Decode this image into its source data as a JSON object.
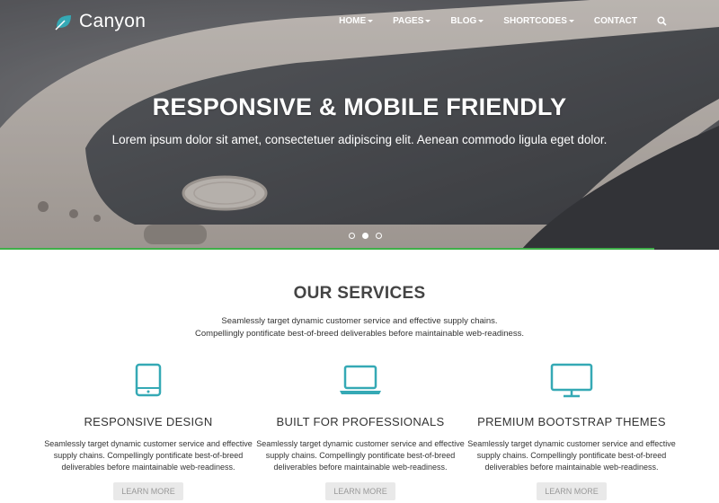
{
  "brand": {
    "name": "Canyon",
    "icon": "leaf-icon"
  },
  "nav": {
    "items": [
      {
        "label": "HOME",
        "dropdown": true
      },
      {
        "label": "PAGES",
        "dropdown": true
      },
      {
        "label": "BLOG",
        "dropdown": true
      },
      {
        "label": "SHORTCODES",
        "dropdown": true
      },
      {
        "label": "CONTACT",
        "dropdown": false
      }
    ],
    "search_icon": "search-icon"
  },
  "hero": {
    "title": "RESPONSIVE & MOBILE FRIENDLY",
    "subtitle": "Lorem ipsum dolor sit amet, consectetuer adipiscing elit. Aenean commodo ligula eget dolor.",
    "slides": 3,
    "active_slide": 2,
    "progress": 0.91
  },
  "services": {
    "title": "OUR SERVICES",
    "intro_line1": "Seamlessly target dynamic customer service and effective supply chains.",
    "intro_line2": "Compellingly pontificate best-of-breed deliverables before maintainable web-readiness.",
    "items": [
      {
        "icon": "tablet-icon",
        "title": "RESPONSIVE DESIGN",
        "text": "Seamlessly target dynamic customer service and effective supply chains. Compellingly pontificate best-of-breed deliverables before maintainable web-readiness.",
        "button": "LEARN MORE"
      },
      {
        "icon": "laptop-icon",
        "title": "BUILT FOR PROFESSIONALS",
        "text": "Seamlessly target dynamic customer service and effective supply chains. Compellingly pontificate best-of-breed deliverables before maintainable web-readiness.",
        "button": "LEARN MORE"
      },
      {
        "icon": "monitor-icon",
        "title": "PREMIUM BOOTSTRAP THEMES",
        "text": "Seamlessly target dynamic customer service and effective supply chains. Compellingly pontificate best-of-breed deliverables before maintainable web-readiness.",
        "button": "LEARN MORE"
      }
    ]
  },
  "colors": {
    "accent": "#35a9b5",
    "progress": "#3fae49",
    "button_bg": "#e9e9e9"
  }
}
